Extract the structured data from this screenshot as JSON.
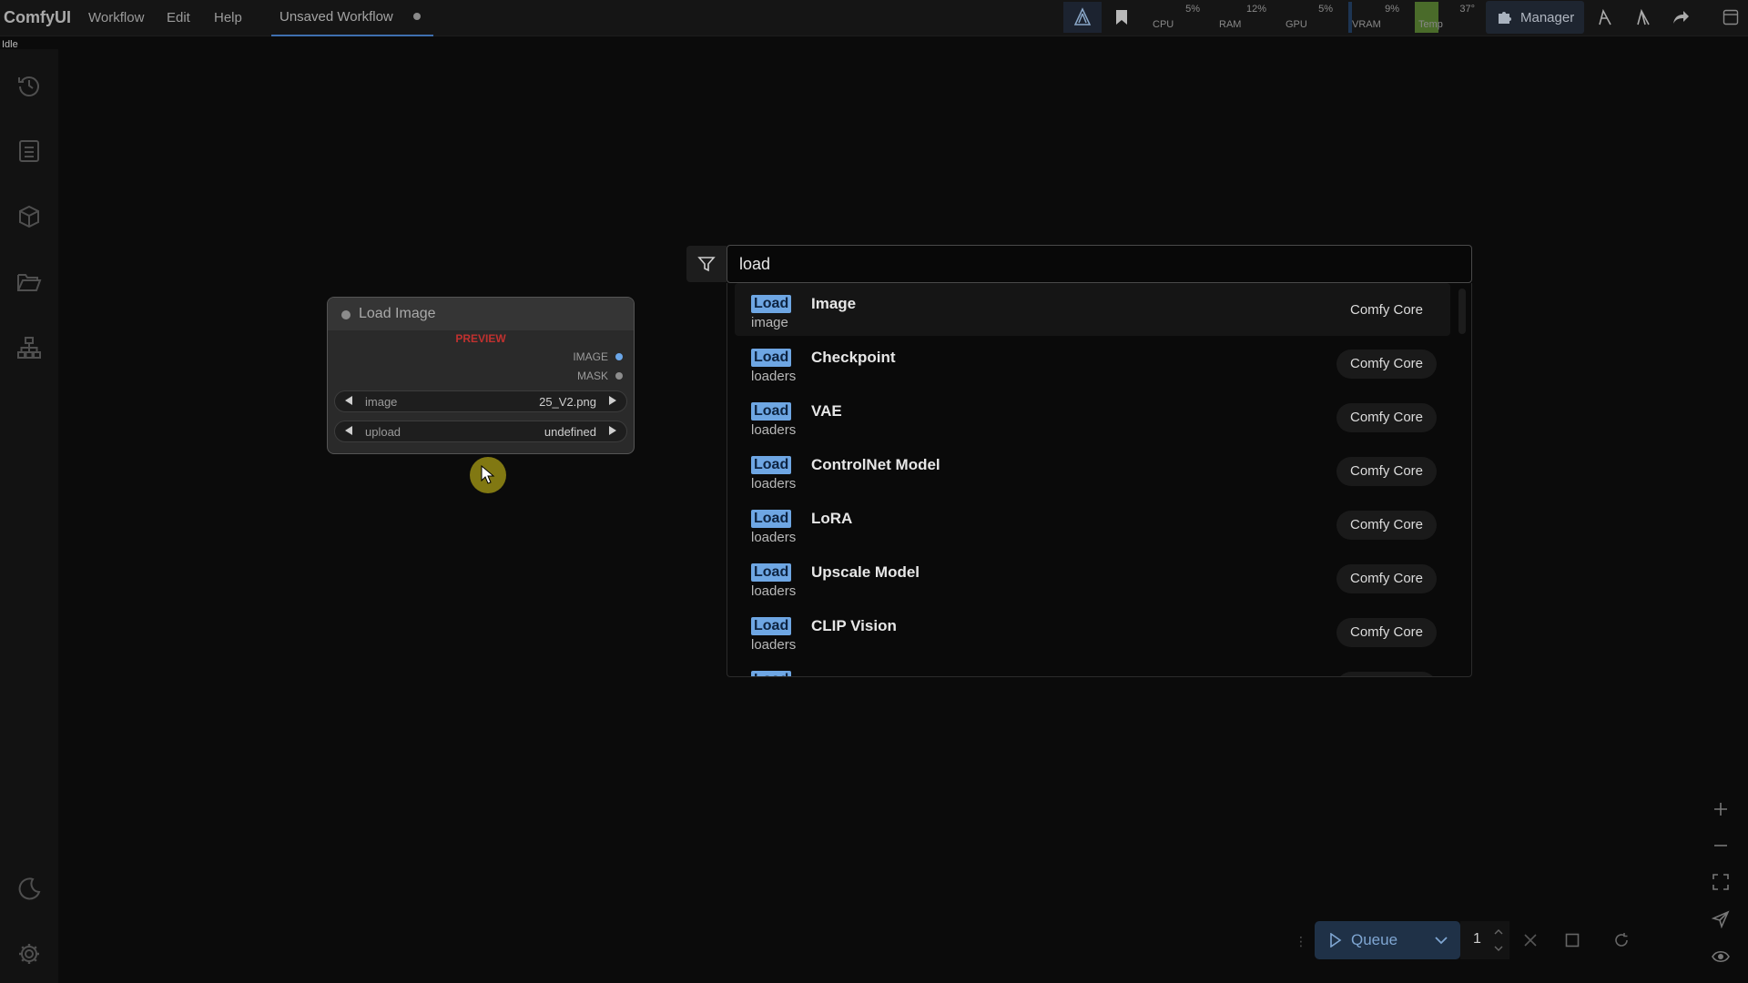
{
  "app": {
    "brand": "ComfyUI",
    "status": "Idle"
  },
  "menu": {
    "workflow": "Workflow",
    "edit": "Edit",
    "help": "Help"
  },
  "tab": {
    "title": "Unsaved Workflow"
  },
  "monitors": [
    {
      "label": "CPU",
      "value": "5%"
    },
    {
      "label": "RAM",
      "value": "12%"
    },
    {
      "label": "GPU",
      "value": "5%"
    },
    {
      "label": "VRAM",
      "value": "9%"
    },
    {
      "label": "Temp",
      "value": "37°"
    }
  ],
  "manager": {
    "label": "Manager"
  },
  "node": {
    "title": "Load Image",
    "preview_label": "PREVIEW",
    "outputs": [
      {
        "name": "IMAGE",
        "color": "#6aa6e8"
      },
      {
        "name": "MASK",
        "color": "#8d8d8d"
      }
    ],
    "widgets": [
      {
        "name": "image",
        "value": "25_V2.png"
      },
      {
        "name": "upload",
        "value": "undefined"
      }
    ]
  },
  "search": {
    "query": "load",
    "highlight": "Load",
    "results": [
      {
        "name": "Image",
        "category": "image",
        "source": "Comfy Core"
      },
      {
        "name": "Checkpoint",
        "category": "loaders",
        "source": "Comfy Core"
      },
      {
        "name": "VAE",
        "category": "loaders",
        "source": "Comfy Core"
      },
      {
        "name": "ControlNet Model",
        "category": "loaders",
        "source": "Comfy Core"
      },
      {
        "name": "LoRA",
        "category": "loaders",
        "source": "Comfy Core"
      },
      {
        "name": "Upscale Model",
        "category": "loaders",
        "source": "Comfy Core"
      },
      {
        "name": "CLIP Vision",
        "category": "loaders",
        "source": "Comfy Core"
      }
    ]
  },
  "queue": {
    "label": "Queue",
    "count": "1"
  },
  "colors": {
    "accent": "#6ea6e3",
    "preview": "#c1312f",
    "queue_bg": "#1f3147",
    "cursor_halo": "#968c14"
  }
}
